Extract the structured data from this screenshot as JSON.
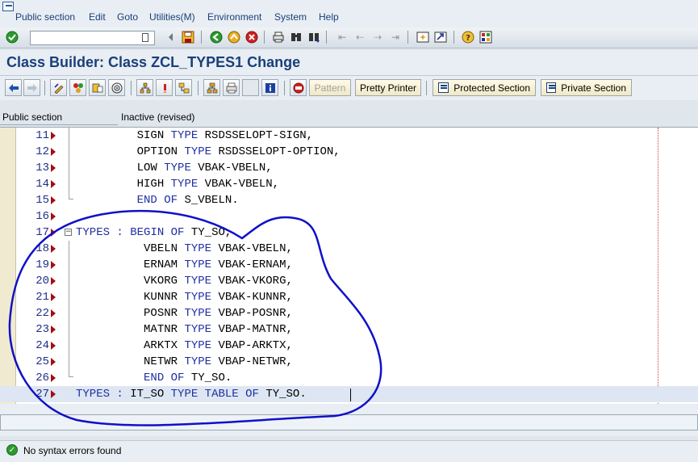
{
  "menu": {
    "items": [
      "Public section",
      "Edit",
      "Goto",
      "Utilities(M)",
      "Environment",
      "System",
      "Help"
    ]
  },
  "toolbar": {
    "command_value": "",
    "icons": [
      "check-icon",
      "back-icon",
      "save-icon",
      "exit-icon",
      "cancel-icon",
      "print-icon",
      "find-icon",
      "find-next-icon",
      "first-page-icon",
      "prev-page-icon",
      "next-page-icon",
      "last-page-icon",
      "new-session-icon",
      "shortcut-icon",
      "help-icon",
      "layout-icon"
    ]
  },
  "title": "Class Builder: Class ZCL_TYPES1 Change",
  "app_toolbar": {
    "pattern_label": "Pattern",
    "pretty_printer_label": "Pretty Printer",
    "protected_section_label": "Protected Section",
    "private_section_label": "Private Section"
  },
  "editor_header": {
    "section": "Public section",
    "status": "Inactive (revised)"
  },
  "code_lines": [
    {
      "num": "11",
      "indent": "         ",
      "tokens": [
        [
          "SIGN ",
          "id"
        ],
        [
          "TYPE ",
          "kw"
        ],
        [
          "RSDSSELOPT-SIGN,",
          "id"
        ]
      ]
    },
    {
      "num": "12",
      "indent": "         ",
      "tokens": [
        [
          "OPTION ",
          "id"
        ],
        [
          "TYPE ",
          "kw"
        ],
        [
          "RSDSSELOPT-OPTION,",
          "id"
        ]
      ]
    },
    {
      "num": "13",
      "indent": "         ",
      "tokens": [
        [
          "LOW ",
          "id"
        ],
        [
          "TYPE ",
          "kw"
        ],
        [
          "VBAK-VBELN,",
          "id"
        ]
      ]
    },
    {
      "num": "14",
      "indent": "         ",
      "tokens": [
        [
          "HIGH ",
          "id"
        ],
        [
          "TYPE ",
          "kw"
        ],
        [
          "VBAK-VBELN,",
          "id"
        ]
      ]
    },
    {
      "num": "15",
      "indent": "         ",
      "tokens": [
        [
          "END ",
          "kw"
        ],
        [
          "OF ",
          "kw"
        ],
        [
          "S_VBELN.",
          "id"
        ]
      ]
    },
    {
      "num": "16",
      "indent": "",
      "tokens": []
    },
    {
      "num": "17",
      "indent": "",
      "tokens": [
        [
          "TYPES ",
          "kw"
        ],
        [
          ": ",
          "kw"
        ],
        [
          "BEGIN ",
          "kw"
        ],
        [
          "OF ",
          "kw"
        ],
        [
          "TY_SO,",
          "id"
        ]
      ]
    },
    {
      "num": "18",
      "indent": "          ",
      "tokens": [
        [
          "VBELN ",
          "id"
        ],
        [
          "TYPE ",
          "kw"
        ],
        [
          "VBAK-VBELN,",
          "id"
        ]
      ]
    },
    {
      "num": "19",
      "indent": "          ",
      "tokens": [
        [
          "ERNAM ",
          "id"
        ],
        [
          "TYPE ",
          "kw"
        ],
        [
          "VBAK-ERNAM,",
          "id"
        ]
      ]
    },
    {
      "num": "20",
      "indent": "          ",
      "tokens": [
        [
          "VKORG ",
          "id"
        ],
        [
          "TYPE ",
          "kw"
        ],
        [
          "VBAK-VKORG,",
          "id"
        ]
      ]
    },
    {
      "num": "21",
      "indent": "          ",
      "tokens": [
        [
          "KUNNR ",
          "id"
        ],
        [
          "TYPE ",
          "kw"
        ],
        [
          "VBAK-KUNNR,",
          "id"
        ]
      ]
    },
    {
      "num": "22",
      "indent": "          ",
      "tokens": [
        [
          "POSNR ",
          "id"
        ],
        [
          "TYPE ",
          "kw"
        ],
        [
          "VBAP-POSNR,",
          "id"
        ]
      ]
    },
    {
      "num": "23",
      "indent": "          ",
      "tokens": [
        [
          "MATNR ",
          "id"
        ],
        [
          "TYPE ",
          "kw"
        ],
        [
          "VBAP-MATNR,",
          "id"
        ]
      ]
    },
    {
      "num": "24",
      "indent": "          ",
      "tokens": [
        [
          "ARKTX ",
          "id"
        ],
        [
          "TYPE ",
          "kw"
        ],
        [
          "VBAP-ARKTX,",
          "id"
        ]
      ]
    },
    {
      "num": "25",
      "indent": "          ",
      "tokens": [
        [
          "NETWR ",
          "id"
        ],
        [
          "TYPE ",
          "kw"
        ],
        [
          "VBAP-NETWR,",
          "id"
        ]
      ]
    },
    {
      "num": "26",
      "indent": "          ",
      "tokens": [
        [
          "END ",
          "kw"
        ],
        [
          "OF ",
          "kw"
        ],
        [
          "TY_SO.",
          "id"
        ]
      ]
    },
    {
      "num": "27",
      "indent": "",
      "tokens": [
        [
          "TYPES ",
          "kw"
        ],
        [
          ": ",
          "kw"
        ],
        [
          "IT_SO ",
          "id"
        ],
        [
          "TYPE ",
          "kw"
        ],
        [
          "TABLE ",
          "kw"
        ],
        [
          "OF ",
          "kw"
        ],
        [
          "TY_SO.",
          "id"
        ]
      ]
    }
  ],
  "status_bar": {
    "message": "No syntax errors found",
    "icon": "check-circle-icon"
  },
  "colors": {
    "keyword": "#1e2fa0",
    "title": "#1a3f7a",
    "annotation": "#1010c8"
  }
}
